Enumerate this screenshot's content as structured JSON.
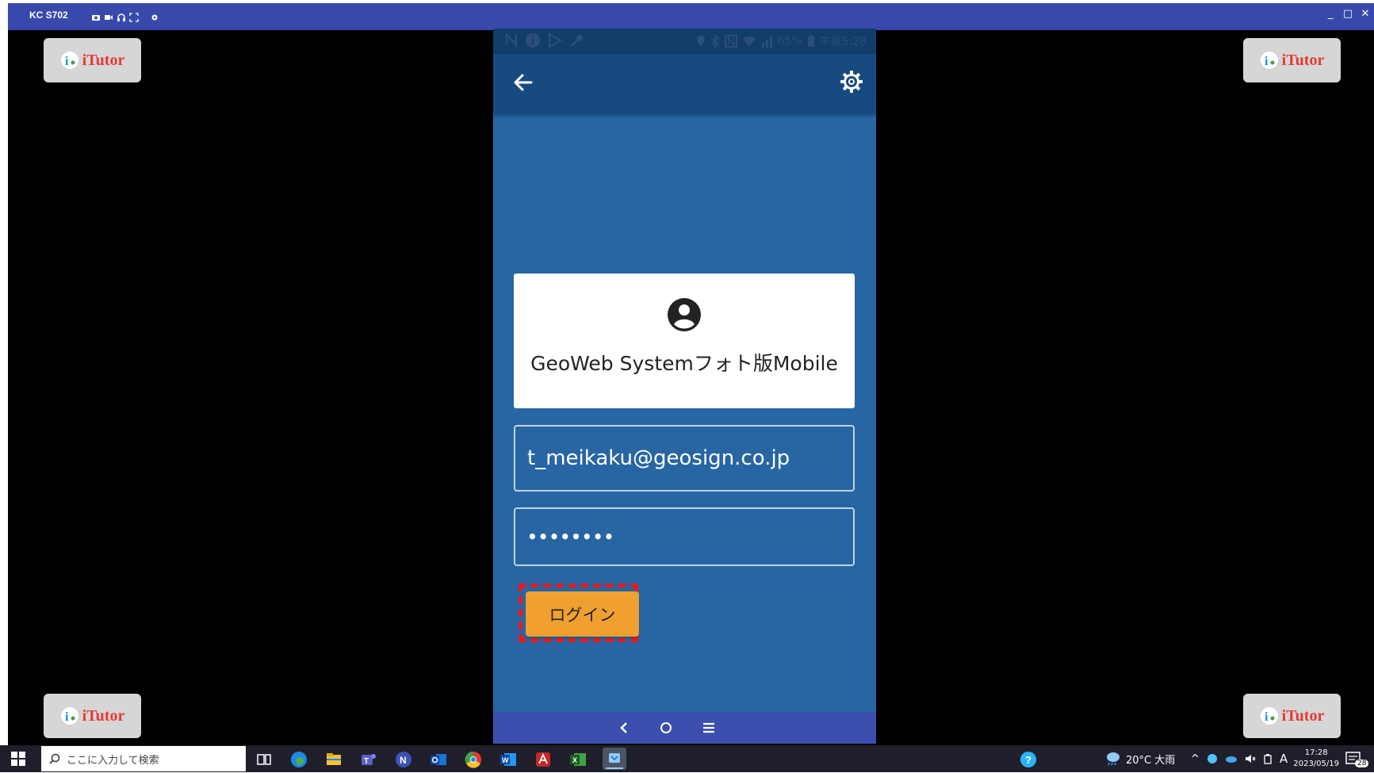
{
  "window": {
    "title": "KC S702",
    "controls": [
      "_",
      "□",
      "✕"
    ]
  },
  "watermark": {
    "brand": "iTutor"
  },
  "phone": {
    "status_time": "午後5:28",
    "status_battery": "65%",
    "app": {
      "title": "GeoWeb Systemフォト版Mobile",
      "email_value": "t_meikaku@geosign.co.jp",
      "password_value": "••••••••",
      "login_label": "ログイン"
    }
  },
  "taskbar": {
    "search_placeholder": "ここに入力して検索",
    "weather": "20°C 大雨",
    "ime": "A",
    "time": "17:28",
    "date": "2023/05/19",
    "notification_count": "28"
  },
  "colors": {
    "titlebar": "#3949ab",
    "phone_bg": "#2766a3",
    "appbar": "#174a7f",
    "login_button": "#f0a030",
    "highlight": "#e01b24"
  }
}
